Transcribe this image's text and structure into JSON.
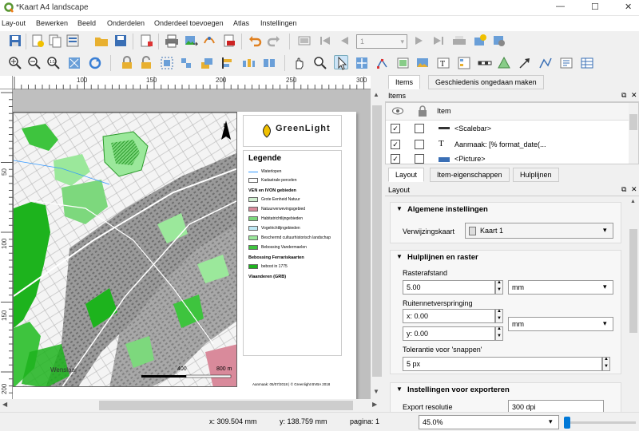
{
  "window": {
    "title": "*Kaart A4 landscape",
    "minimize": "—",
    "maximize": "☐",
    "close": "✕"
  },
  "menu": [
    "Lay-out",
    "Bewerken",
    "Beeld",
    "Onderdelen",
    "Onderdeel toevoegen",
    "Atlas",
    "Instellingen"
  ],
  "toolbar1": {
    "page_value": "1"
  },
  "ruler_h": [
    "100",
    "150",
    "200",
    "250",
    "300"
  ],
  "ruler_v": [
    "50",
    "100",
    "150",
    "200"
  ],
  "map": {
    "scalebar_left": "400",
    "scalebar_right": "800 m",
    "label_tehuis": "Wenslaar"
  },
  "logo": {
    "name": "GreenLight",
    "tagline": "GREENLIGHT"
  },
  "legend": {
    "title": "Legende",
    "items1": [
      "Waterlopen",
      "Kadastrale percelen"
    ],
    "group1": "VEN en IVON gebieden",
    "items2": [
      "Grote Eenheid Natuur",
      "Natuurverwevingsgebied",
      "Habitatrichtlijngebieden",
      "Vogelrichtlijngebieden",
      "Beschermd cultuurhistorisch landschap",
      "Bebossing Vandermaelen"
    ],
    "group2": "Bebossing Ferrariskaarten",
    "items3": [
      "bebost in 1775"
    ],
    "group3": "Vlaanderen (GRB)"
  },
  "footer_note": "Aanmaak: 05/07/2018 | © Greenlight BVBA 2018",
  "panel": {
    "tabs_top": [
      "Items",
      "Geschiedenis ongedaan maken"
    ],
    "items_header": "Items",
    "items_col": "Item",
    "items": [
      "<Scalebar>",
      "Aanmaak: [% format_date(...",
      "<Picture>"
    ],
    "tabs_mid": [
      "Layout",
      "Item-eigenschappen",
      "Hulplijnen"
    ],
    "layout_header": "Layout",
    "sec1": "Algemene instellingen",
    "ref_map_label": "Verwijzingskaart",
    "ref_map_value": "Kaart 1",
    "sec2": "Hulplijnen en raster",
    "grid_spacing_label": "Rasterafstand",
    "grid_spacing_value": "5.00",
    "grid_spacing_unit": "mm",
    "grid_offset_label": "Ruitennetverspringing",
    "offset_x": "x: 0.00",
    "offset_y": "y: 0.00",
    "offset_unit": "mm",
    "snap_label": "Tolerantie voor 'snappen'",
    "snap_value": "5 px",
    "sec3": "Instellingen voor exporteren",
    "export_label": "Export resolutie",
    "export_value": "300 dpi"
  },
  "status": {
    "x": "x: 309.504 mm",
    "y": "y: 138.759 mm",
    "page": "pagina: 1",
    "zoom": "45.0%"
  },
  "colors": {
    "accent": "#0078d7",
    "green_dark": "#1db31d",
    "green_light": "#9be89b"
  }
}
